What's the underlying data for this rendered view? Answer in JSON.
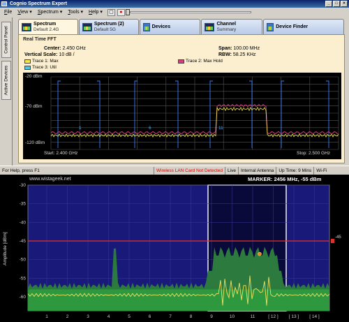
{
  "app": {
    "title": "Cognio Spectrum Expert",
    "window_buttons": [
      "_",
      "□",
      "×"
    ]
  },
  "menu": {
    "items": [
      {
        "label": "File",
        "underline": "F",
        "rest": "ile"
      },
      {
        "label": "View",
        "underline": "V",
        "rest": "iew ▾"
      },
      {
        "label": "Spectrum",
        "underline": "S",
        "rest": "pectrum ▾"
      },
      {
        "label": "Tools",
        "underline": "T",
        "rest": "ools ▾"
      },
      {
        "label": "Help",
        "underline": "H",
        "rest": "elp ▾"
      }
    ]
  },
  "side_tabs": [
    "Control Panel",
    "Active Devices"
  ],
  "tabs": [
    {
      "title": "Spectrum",
      "subtitle": "Default  2.4G",
      "active": true,
      "icon": "spectrum-icon"
    },
    {
      "title": "Spectrum (2)",
      "subtitle": "Default  5G",
      "active": false,
      "icon": "spectrum-icon"
    },
    {
      "title": "Devices",
      "subtitle": "",
      "active": false,
      "icon": "devices-icon"
    },
    {
      "title": "Channel",
      "subtitle": "Summary",
      "active": false,
      "icon": "channel-icon"
    },
    {
      "title": "Device Finder",
      "subtitle": "",
      "active": false,
      "icon": "finder-icon"
    }
  ],
  "fft": {
    "title": "Real Time FFT",
    "center_label": "Center:",
    "center_value": "2.450 GHz",
    "span_label": "Span:",
    "span_value": "100.00 MHz",
    "vscale_label": "Vertical Scale:",
    "vscale_value": "10 dB /",
    "rbw_label": "RBW:",
    "rbw_value": "58.25 KHz",
    "legend": [
      {
        "label": "Trace 1: Max",
        "color": "#f5e84c"
      },
      {
        "label": "Trace 2: Max Hold",
        "color": "#d04080"
      },
      {
        "label": "Trace 3: Util",
        "color": "#4cc4e0"
      }
    ],
    "y_labels": [
      "-20 dBm",
      "-70 dBm",
      "-120 dBm"
    ],
    "start": "Start: 2.400 GHz",
    "stop": "Stop: 2.500 GHz",
    "channel_marks": [
      "1",
      "6",
      "11"
    ]
  },
  "status": {
    "help": "For Help, press F1",
    "card": "Wireless LAN Card Not Detected",
    "live": "Live",
    "antenna": "Internal Antenna",
    "uptime": "Up Time: 9 Mins",
    "wifi": "Wi-Fi"
  },
  "graph": {
    "site": "www.wistageek.net",
    "marker": "MARKER: 2456 MHz, -55 dBm",
    "ylabel": "Amplitude [dBm]",
    "y_ticks": [
      "-30",
      "-35",
      "-40",
      "-45",
      "-50",
      "-55",
      "-60"
    ],
    "x_ticks": [
      "1",
      "2",
      "3",
      "4",
      "5",
      "6",
      "7",
      "8",
      "9",
      "10",
      "11",
      "[ 12 ]",
      "[ 13 ]",
      "[ 14 ]"
    ],
    "threshold_label": "-45",
    "colors": {
      "bg": "#19197a",
      "fill_low": "#2d7a3f",
      "fill_high": "#2e9e3e",
      "trace": "#f0e060",
      "threshold": "#e0302c"
    }
  }
}
